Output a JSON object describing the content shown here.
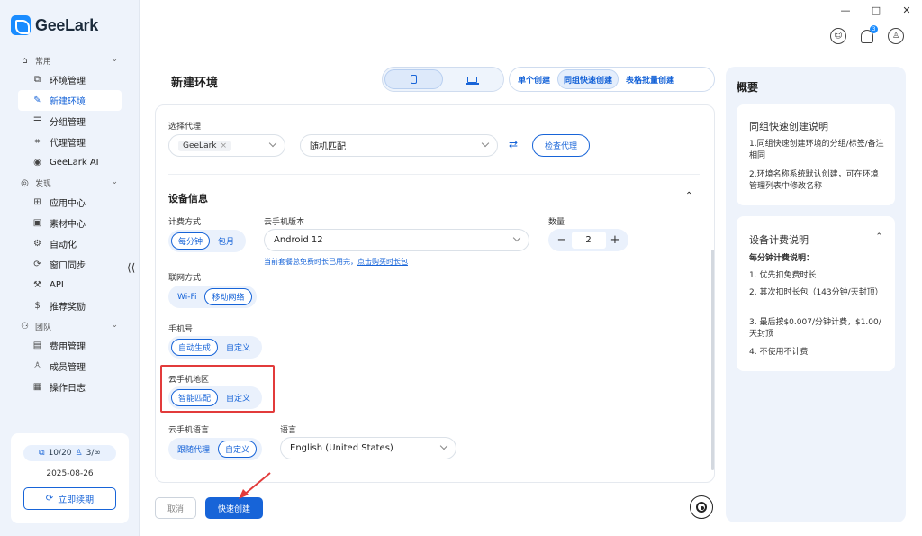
{
  "window": {
    "minimize": "—",
    "maximize": "□",
    "close": "✕"
  },
  "app": {
    "name": "GeeLark"
  },
  "sidebar": {
    "groups": [
      {
        "label": "常用",
        "items": [
          {
            "label": "环境管理"
          },
          {
            "label": "新建环境",
            "active": true
          },
          {
            "label": "分组管理"
          },
          {
            "label": "代理管理"
          },
          {
            "label": "GeeLark AI"
          }
        ]
      },
      {
        "label": "发现",
        "items": [
          {
            "label": "应用中心"
          },
          {
            "label": "素材中心"
          },
          {
            "label": "自动化"
          },
          {
            "label": "窗口同步"
          },
          {
            "label": "API"
          },
          {
            "label": "推荐奖励"
          }
        ]
      },
      {
        "label": "团队",
        "items": [
          {
            "label": "费用管理"
          },
          {
            "label": "成员管理"
          },
          {
            "label": "操作日志"
          }
        ]
      }
    ],
    "account": {
      "quota_devices": "10/20",
      "quota_members": "3/∞",
      "expire_date": "2025-08-26",
      "renew_label": "立即续期"
    }
  },
  "header": {
    "title": "新建环境",
    "mode_tabs": [
      {
        "label": "单个创建"
      },
      {
        "label": "同组快速创建",
        "active": true
      },
      {
        "label": "表格批量创建"
      }
    ],
    "notification_count": "3"
  },
  "form": {
    "proxy": {
      "label": "选择代理",
      "chip": "GeeLark",
      "match_value": "随机匹配",
      "check_label": "检查代理"
    },
    "device_section_title": "设备信息",
    "billing": {
      "label": "计费方式",
      "options": [
        "每分钟",
        "包月"
      ],
      "selected": 0
    },
    "phone_version": {
      "label": "云手机版本",
      "value": "Android 12",
      "hint_prefix": "当前套餐总免费时长已用完，",
      "hint_link": "点击购买时长包"
    },
    "quantity": {
      "label": "数量",
      "value": "2",
      "minus": "−",
      "plus": "+"
    },
    "network": {
      "label": "联网方式",
      "options": [
        "Wi-Fi",
        "移动网络"
      ],
      "selected": 1
    },
    "phone_number": {
      "label": "手机号",
      "options": [
        "自动生成",
        "自定义"
      ],
      "selected": 0
    },
    "region": {
      "label": "云手机地区",
      "options": [
        "智能匹配",
        "自定义"
      ],
      "selected": 0
    },
    "phone_language": {
      "label": "云手机语言",
      "options": [
        "跟随代理",
        "自定义"
      ],
      "selected": 1
    },
    "language": {
      "label": "语言",
      "value": "English (United States)"
    }
  },
  "footer": {
    "cancel_label": "取消",
    "create_label": "快速创建"
  },
  "overview": {
    "title": "概要",
    "quick_create": {
      "title": "同组快速创建说明",
      "lines": [
        "1.同组快速创建环境的分组/标签/备注相同",
        "2.环境名称系统默认创建，可在环境管理列表中修改名称"
      ]
    },
    "billing_info": {
      "title": "设备计费说明",
      "subtitle": "每分钟计费说明：",
      "lines": [
        "1. 优先扣免费时长",
        "2. 其次扣时长包（143分钟/天封顶）",
        "3. 最后按$0.007/分钟计费，$1.00/天封顶",
        "4. 不使用不计费"
      ]
    }
  },
  "colors": {
    "accent": "#1764d8",
    "sidebar_bg": "#eef3fb",
    "highlight": "#e23b3b"
  }
}
